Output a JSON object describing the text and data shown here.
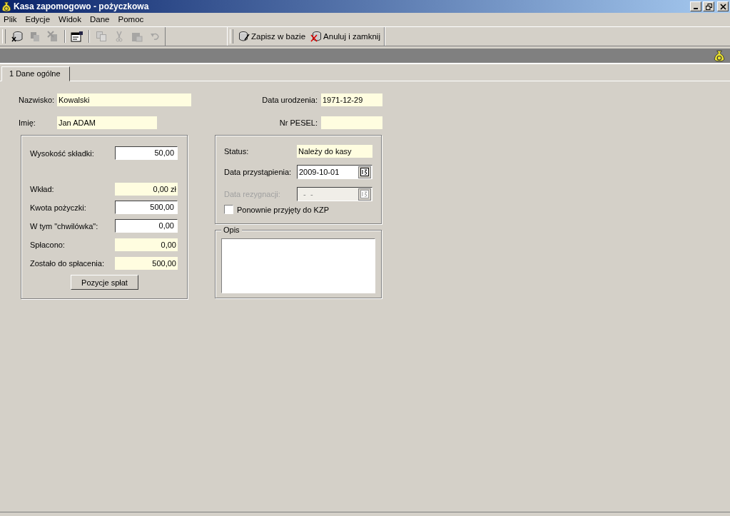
{
  "window": {
    "title": "Kasa zapomogowo - pożyczkowa"
  },
  "menu": [
    "Plik",
    "Edycje",
    "Widok",
    "Dane",
    "Pomoc"
  ],
  "toolbar": {
    "icon_buttons": [
      {
        "disabled": false
      },
      {
        "disabled": true
      },
      {
        "disabled": true
      },
      {
        "disabled": false
      },
      {
        "disabled": true
      },
      {
        "disabled": true
      },
      {
        "disabled": true
      },
      {
        "disabled": true
      }
    ],
    "actions": [
      {
        "label": "Zapisz w bazie",
        "disabled": false
      },
      {
        "label": "Anuluj i zamknij",
        "disabled": false
      }
    ]
  },
  "tabs": [
    {
      "label": "1 Dane ogólne",
      "selected": true
    }
  ],
  "person": {
    "left": [
      {
        "label": "Nazwisko:",
        "value": "Kowalski"
      },
      {
        "label": "Imię:",
        "value": "Jan ADAM"
      }
    ],
    "right": [
      {
        "label": "Data urodzenia:",
        "value": "1971-12-29"
      },
      {
        "label": "Nr PESEL:"
      }
    ]
  },
  "finance": {
    "rows": [
      {
        "label": "Wysokość składki:",
        "value": "50,00",
        "kind": "input"
      },
      {
        "label": "Wkład:",
        "value": "0,00 zł",
        "kind": "readonly"
      },
      {
        "label": "Kwota pożyczki:",
        "value": "500,00",
        "kind": "input"
      },
      {
        "label": "W tym \"chwilówka\":",
        "value": "0,00",
        "kind": "input"
      },
      {
        "label": "Spłacono:",
        "value": "0,00",
        "kind": "readonly"
      },
      {
        "label": "Zostało do spłacenia:",
        "value": "500,00",
        "kind": "readonly"
      }
    ],
    "button": "Pozycje spłat"
  },
  "membership": {
    "status_label": "Status:",
    "status": "Należy do kasy",
    "dates": [
      {
        "label": "Data przystąpienia:",
        "value": "2009-10-01",
        "disabled": false
      },
      {
        "label": "Data rezygnacji:",
        "value": "  -  -",
        "disabled": true
      }
    ],
    "checkbox": {
      "label": "Ponownie przyjęty do KZP",
      "checked": false
    }
  },
  "notes": {
    "title": "Opis"
  }
}
